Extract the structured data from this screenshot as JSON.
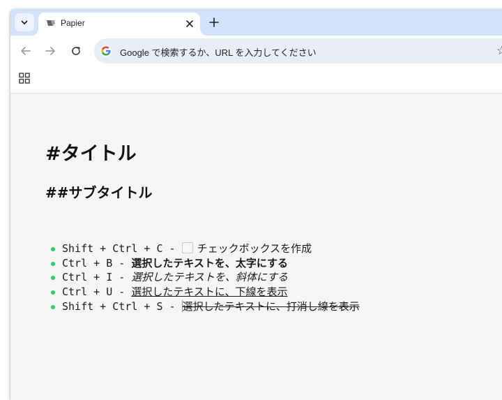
{
  "browser": {
    "tab": {
      "title": "Papier"
    },
    "omnibox": {
      "placeholder": "Google で検索するか、URL を入力してください"
    }
  },
  "page": {
    "title": "#タイトル",
    "subtitle": "##サブタイトル",
    "shortcuts": [
      {
        "keys": "Shift + Ctrl + C  - ",
        "description": "チェックボックスを作成",
        "style": "checkbox"
      },
      {
        "keys": "Ctrl + B  - ",
        "description": "選択したテキストを、太字にする",
        "style": "bold"
      },
      {
        "keys": "Ctrl + I  - ",
        "description": "選択したテキストを、斜体にする",
        "style": "italic"
      },
      {
        "keys": "Ctrl + U  - ",
        "description": "選択したテキストに、下線を表示",
        "style": "underline"
      },
      {
        "keys": "Shift + Ctrl + S  - ",
        "description": "選択したテキストに、打消し線を表示",
        "style": "strikethrough"
      }
    ]
  },
  "colors": {
    "tabstrip": "#d3e3fd",
    "page_background": "#f5f5f5",
    "bullet": "#2ecc71"
  }
}
